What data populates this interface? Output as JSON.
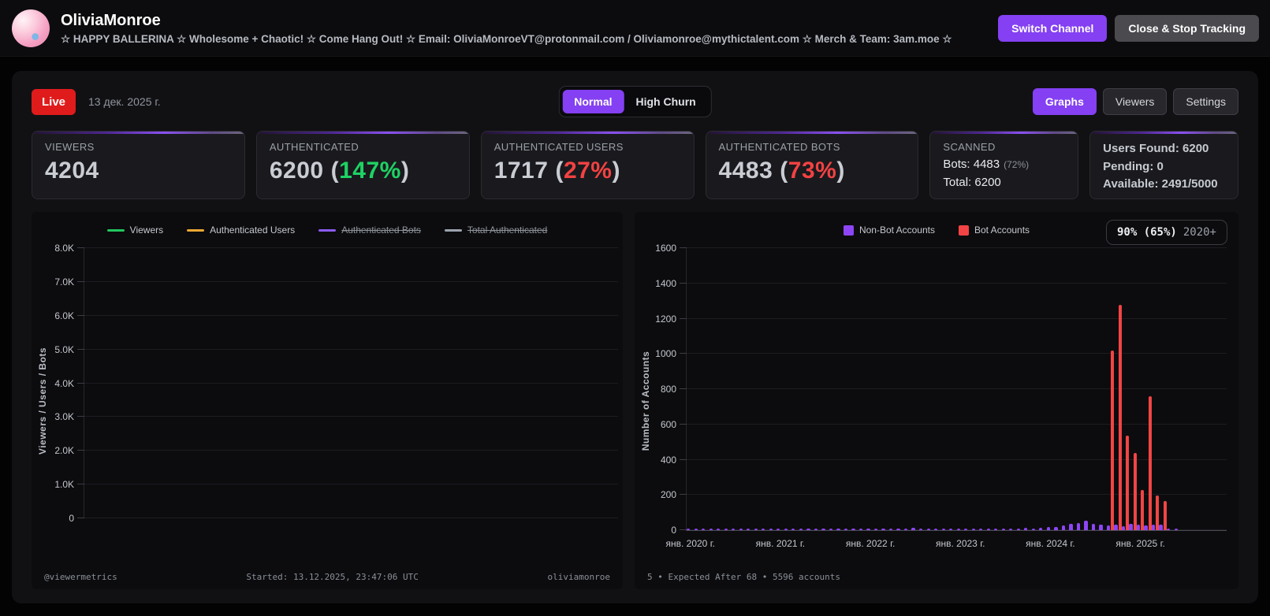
{
  "header": {
    "channel_name": "OliviaMonroe",
    "channel_description": "☆ HAPPY BALLERINA ☆ Wholesome + Chaotic! ☆ Come Hang Out! ☆ Email: OliviaMonroeVT@protonmail.com / Oliviamonroe@mythictalent.com ☆ Merch & Team: 3am.moe ☆",
    "buttons": {
      "switch_channel": "Switch Channel",
      "close_stop": "Close & Stop Tracking"
    }
  },
  "controls": {
    "live_badge": "Live",
    "date": "13 дек. 2025 г.",
    "mode_toggle": {
      "normal": "Normal",
      "high_churn": "High Churn",
      "selected": "Normal"
    },
    "view_buttons": {
      "graphs": "Graphs",
      "viewers": "Viewers",
      "settings": "Settings",
      "selected": "Graphs"
    }
  },
  "punct": {
    "open_paren": "(",
    "close_paren": ")"
  },
  "stats_cards": {
    "viewers": {
      "label": "VIEWERS",
      "value": "4204"
    },
    "authenticated": {
      "label": "AUTHENTICATED",
      "value": "6200",
      "percent": "147%",
      "percent_class": "pct green"
    },
    "authenticated_users": {
      "label": "AUTHENTICATED USERS",
      "value": "1717",
      "percent": "27%",
      "percent_class": "pct red"
    },
    "authenticated_bots": {
      "label": "AUTHENTICATED BOTS",
      "value": "4483",
      "percent": "73%",
      "percent_class": "pct red"
    },
    "scanned": {
      "label": "SCANNED",
      "bots_line": "Bots: 4483",
      "bots_percent": "(72%)",
      "total_line": "Total: 6200"
    },
    "capacity": {
      "line1": "Users Found: 6200",
      "line2": "Pending: 0",
      "line3": "Available: 2491/5000"
    }
  },
  "chart_data": [
    {
      "type": "line",
      "title": "",
      "ylabel": "Viewers / Users / Bots",
      "ylim": [
        0,
        8000
      ],
      "yticks_top_to_bottom": [
        "8.0K",
        "7.0K",
        "6.0K",
        "5.0K",
        "4.0K",
        "3.0K",
        "2.0K",
        "1.0K",
        "0"
      ],
      "grid": true,
      "legend_position": "top",
      "legend": [
        {
          "name": "Viewers",
          "color": "#22c55e",
          "hidden": false
        },
        {
          "name": "Authenticated Users",
          "color": "#eba834",
          "hidden": false
        },
        {
          "name": "Authenticated Bots",
          "color": "#8b5cf6",
          "hidden": true
        },
        {
          "name": "Total Authenticated",
          "color": "#9ca3af",
          "hidden": true
        }
      ],
      "series": [
        {
          "name": "Viewers",
          "color": "#22c55e",
          "values": []
        },
        {
          "name": "Authenticated Users",
          "color": "#eba834",
          "values": []
        },
        {
          "name": "Authenticated Bots",
          "color": "#8b5cf6",
          "values": []
        },
        {
          "name": "Total Authenticated",
          "color": "#9ca3af",
          "values": []
        }
      ],
      "footer": {
        "left": "@viewermetrics",
        "center": "Started: 13.12.2025, 23:47:06 UTC",
        "right": "oliviamonroe"
      }
    },
    {
      "type": "bar",
      "title": "",
      "ylabel": "Number of Accounts",
      "ylim": [
        0,
        1600
      ],
      "yticks_bottom_to_top": [
        "0",
        "200",
        "400",
        "600",
        "800",
        "1000",
        "1200",
        "1400",
        "1600"
      ],
      "grid": true,
      "legend_position": "top",
      "badge": {
        "main": "90% (65%)",
        "suffix": "2020+"
      },
      "x_start_month": "2020-01",
      "months_per_bar": 1,
      "xtick_labels": [
        "янв. 2020 г.",
        "янв. 2021 г.",
        "янв. 2022 г.",
        "янв. 2023 г.",
        "янв. 2024 г.",
        "янв. 2025 г."
      ],
      "xtick_positions": [
        0,
        12,
        24,
        36,
        48,
        60
      ],
      "series": [
        {
          "name": "Non-Bot Accounts",
          "color": "#8d45f5",
          "values": [
            2,
            4,
            3,
            5,
            6,
            4,
            6,
            3,
            5,
            4,
            6,
            3,
            2,
            4,
            5,
            6,
            4,
            10,
            9,
            6,
            4,
            6,
            5,
            7,
            8,
            6,
            7,
            5,
            6,
            5,
            12,
            9,
            6,
            4,
            6,
            8,
            6,
            5,
            8,
            10,
            8,
            6,
            11,
            9,
            8,
            12,
            10,
            14,
            16,
            20,
            28,
            34,
            42,
            55,
            38,
            30,
            26,
            30,
            24,
            34,
            30,
            28,
            32,
            30,
            8,
            3,
            0,
            0,
            0,
            0,
            0,
            0
          ]
        },
        {
          "name": "Bot Accounts",
          "color": "#f24444",
          "values": [
            0,
            0,
            0,
            0,
            0,
            0,
            0,
            0,
            0,
            0,
            0,
            0,
            0,
            0,
            0,
            0,
            0,
            0,
            0,
            0,
            0,
            0,
            0,
            0,
            0,
            0,
            0,
            0,
            0,
            0,
            0,
            0,
            0,
            0,
            0,
            0,
            0,
            0,
            0,
            0,
            0,
            0,
            0,
            0,
            0,
            0,
            0,
            0,
            0,
            0,
            0,
            0,
            0,
            0,
            0,
            0,
            1020,
            1280,
            535,
            440,
            230,
            760,
            195,
            165,
            0,
            0,
            0,
            0,
            0,
            0,
            0,
            0
          ]
        }
      ],
      "footer": "5 • Expected After 68 • 5596 accounts"
    }
  ]
}
